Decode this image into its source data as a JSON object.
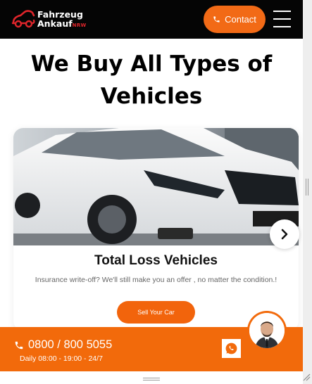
{
  "header": {
    "logo_line1": "Fahrzeug",
    "logo_line2": "Ankauf",
    "logo_suffix": "NRW",
    "contact_label": "Contact",
    "menu_icon": "hamburger-menu-icon"
  },
  "hero": {
    "title_line1": "We Buy All Types of",
    "title_line2": "Vehicles"
  },
  "card": {
    "image_subject": "white car",
    "title": "Total Loss Vehicles",
    "description": "Insurance write-off? We'll still make you an offer , no matter the condition.!",
    "button_label": "Sell Your Car",
    "next_icon": "chevron-right-icon"
  },
  "bottom_bar": {
    "phone": "0800 / 800 5055",
    "hours": "Daily 08:00 - 19:00 - 24/7",
    "whatsapp_icon": "whatsapp-icon",
    "agent_icon": "support-agent-avatar"
  },
  "colors": {
    "accent": "#f26a16",
    "header_bg": "#050505",
    "logo_red": "#e0252b"
  }
}
